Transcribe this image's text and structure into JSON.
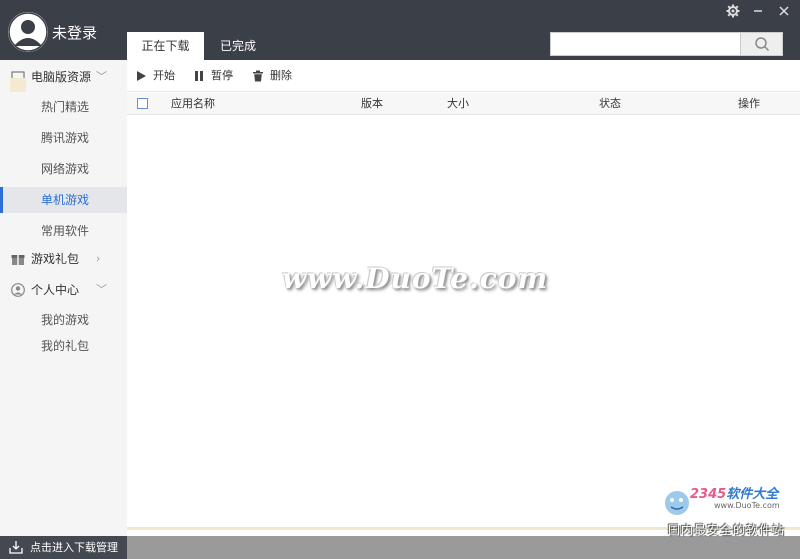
{
  "header": {
    "user_label": "未登录",
    "tabs": [
      {
        "label": "正在下载"
      },
      {
        "label": "已完成"
      }
    ],
    "search": {
      "placeholder": ""
    },
    "window_controls": [
      "gear-icon",
      "minimize-icon",
      "close-icon"
    ]
  },
  "sidebar": {
    "groups": [
      {
        "label": "电脑版资源",
        "icon": "monitor-icon",
        "expanded": true,
        "items": [
          "热门精选",
          "腾讯游戏",
          "网络游戏",
          "单机游戏",
          "常用软件"
        ]
      },
      {
        "label": "游戏礼包",
        "icon": "gift-icon",
        "expanded": false,
        "items": []
      },
      {
        "label": "个人中心",
        "icon": "person-icon",
        "expanded": true,
        "items": [
          "我的游戏",
          "我的礼包"
        ]
      }
    ],
    "active_item": "单机游戏",
    "footer_label": "点击进入下载管理"
  },
  "toolbar": {
    "start_label": "开始",
    "pause_label": "暂停",
    "delete_label": "删除"
  },
  "table": {
    "columns": [
      "应用名称",
      "版本",
      "大小",
      "状态",
      "操作"
    ],
    "rows": []
  },
  "watermark": {
    "text": "www.DuoTe.com"
  },
  "logo": {
    "prefix": "2345",
    "brand": "软件大全",
    "url": "www.DuoTe.com",
    "tagline": "国内最安全的软件站"
  },
  "colors": {
    "header_bg": "#3b3f48",
    "accent": "#2a6fd6",
    "sidebar_bg": "#f5f5f5"
  }
}
